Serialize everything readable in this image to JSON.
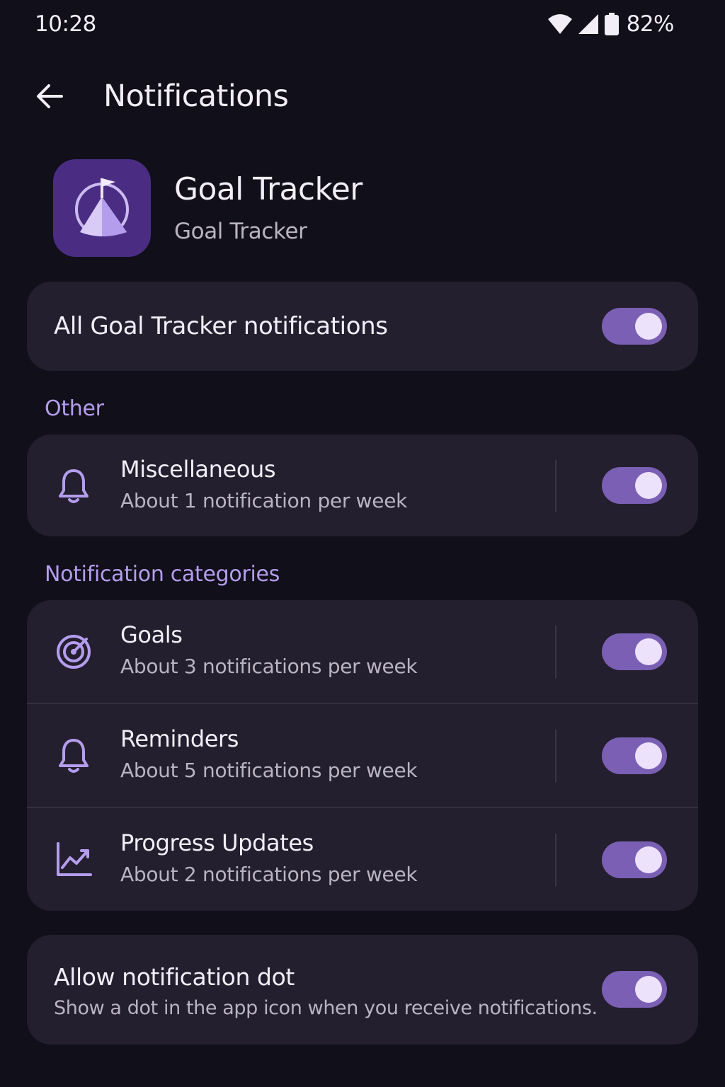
{
  "status_bar": {
    "time": "10:28",
    "battery_percent": "82%",
    "icons": [
      "wifi-icon",
      "signal-icon",
      "battery-icon"
    ]
  },
  "header": {
    "title": "Notifications",
    "back_icon": "arrow-back-icon"
  },
  "app": {
    "name": "Goal Tracker",
    "subtitle": "Goal Tracker",
    "icon": "mountain-flag-icon"
  },
  "all_notifications": {
    "label": "All Goal Tracker notifications",
    "enabled": true
  },
  "other_section": {
    "heading": "Other",
    "items": [
      {
        "title": "Miscellaneous",
        "subtitle": "About 1 notification per week",
        "icon": "bell-icon",
        "enabled": true
      }
    ]
  },
  "categories_section": {
    "heading": "Notification categories",
    "items": [
      {
        "title": "Goals",
        "subtitle": "About 3 notifications per week",
        "icon": "target-icon",
        "enabled": true
      },
      {
        "title": "Reminders",
        "subtitle": "About 5 notifications per week",
        "icon": "bell-icon",
        "enabled": true
      },
      {
        "title": "Progress Updates",
        "subtitle": "About 2 notifications per week",
        "icon": "trending-up-icon",
        "enabled": true
      }
    ]
  },
  "notification_dot": {
    "title": "Allow notification dot",
    "subtitle": "Show a dot in the app icon when you receive notifications.",
    "enabled": true
  },
  "colors": {
    "background": "#110f19",
    "card": "#231f2e",
    "accent": "#b59dee",
    "toggle_track": "#7b5fb4",
    "toggle_knob": "#ede2fb",
    "app_icon_bg": "#4a2d83"
  }
}
